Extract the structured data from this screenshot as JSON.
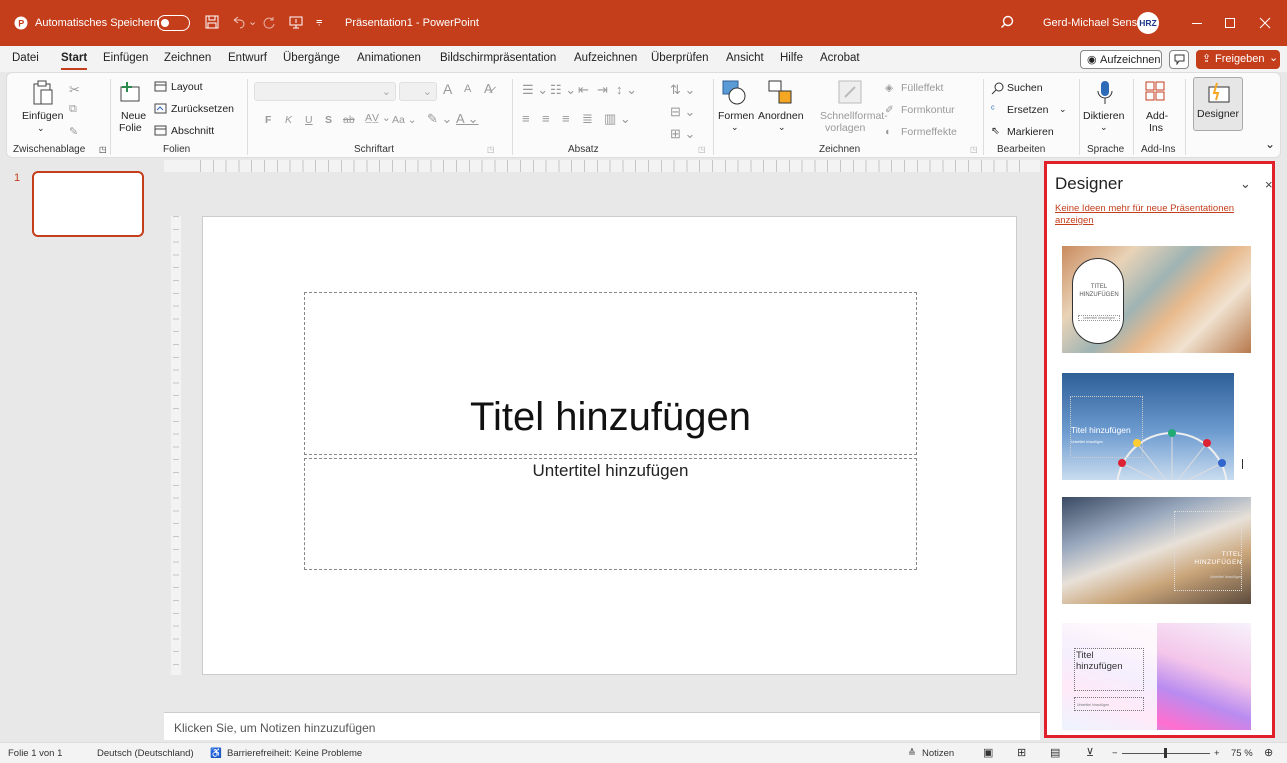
{
  "titlebar": {
    "autosave_label": "Automatisches Speichern",
    "doc_title": "Präsentation1 - PowerPoint",
    "user": "Gerd-Michael Sens",
    "avatar_text": "HRZ"
  },
  "menu": {
    "tabs": [
      "Datei",
      "Start",
      "Einfügen",
      "Zeichnen",
      "Entwurf",
      "Übergänge",
      "Animationen",
      "Bildschirmpräsentation",
      "Aufzeichnen",
      "Überprüfen",
      "Ansicht",
      "Hilfe",
      "Acrobat"
    ],
    "record_label": "Aufzeichnen",
    "share_label": "Freigeben"
  },
  "ribbon": {
    "clipboard": {
      "paste": "Einfügen",
      "group": "Zwischenablage"
    },
    "slides": {
      "new_slide_1": "Neue",
      "new_slide_2": "Folie",
      "layout": "Layout",
      "reset": "Zurücksetzen",
      "section": "Abschnitt",
      "group": "Folien"
    },
    "font": {
      "group": "Schriftart",
      "font_size_up": "A",
      "font_size_down": "A"
    },
    "paragraph": {
      "group": "Absatz"
    },
    "drawing": {
      "shapes": "Formen",
      "arrange": "Anordnen",
      "quick_styles_1": "Schnellformat-",
      "quick_styles_2": "vorlagen",
      "fill": "Fülleffekt",
      "outline": "Formkontur",
      "effects": "Formeffekte",
      "group": "Zeichnen"
    },
    "editing": {
      "find": "Suchen",
      "replace": "Ersetzen",
      "select": "Markieren",
      "group": "Bearbeiten"
    },
    "voice": {
      "dictate": "Diktieren",
      "group": "Sprache"
    },
    "addins": {
      "label_1": "Add-",
      "label_2": "Ins",
      "group": "Add-Ins"
    },
    "designer": {
      "label": "Designer"
    }
  },
  "thumbnails": [
    {
      "number": "1"
    }
  ],
  "slide": {
    "title": "Titel hinzufügen",
    "subtitle": "Untertitel hinzufügen"
  },
  "notes": {
    "placeholder": "Klicken Sie, um Notizen hinzuzufügen"
  },
  "designer": {
    "title": "Designer",
    "link": "Keine Ideen mehr für neue Präsentationen anzeigen",
    "ideas": [
      {
        "title": "TITEL HINZUFÜGEN",
        "subtitle": "Untertitel hinzufügen"
      },
      {
        "title": "Titel hinzufügen",
        "subtitle": "Untertitel hinzufügen"
      },
      {
        "title": "TITEL HINZUFÜGEN",
        "subtitle": "Untertitel hinzufügen"
      },
      {
        "title": "Titel hinzufügen",
        "subtitle": "Untertitel hinzufügen"
      }
    ]
  },
  "statusbar": {
    "slide_info": "Folie 1 von 1",
    "language": "Deutsch (Deutschland)",
    "accessibility": "Barrierefreiheit: Keine Probleme",
    "notes": "Notizen",
    "zoom": "75 %"
  },
  "colors": {
    "accent": "#c43e1c",
    "designer_border": "#e0202a",
    "link": "#c43e1c"
  }
}
